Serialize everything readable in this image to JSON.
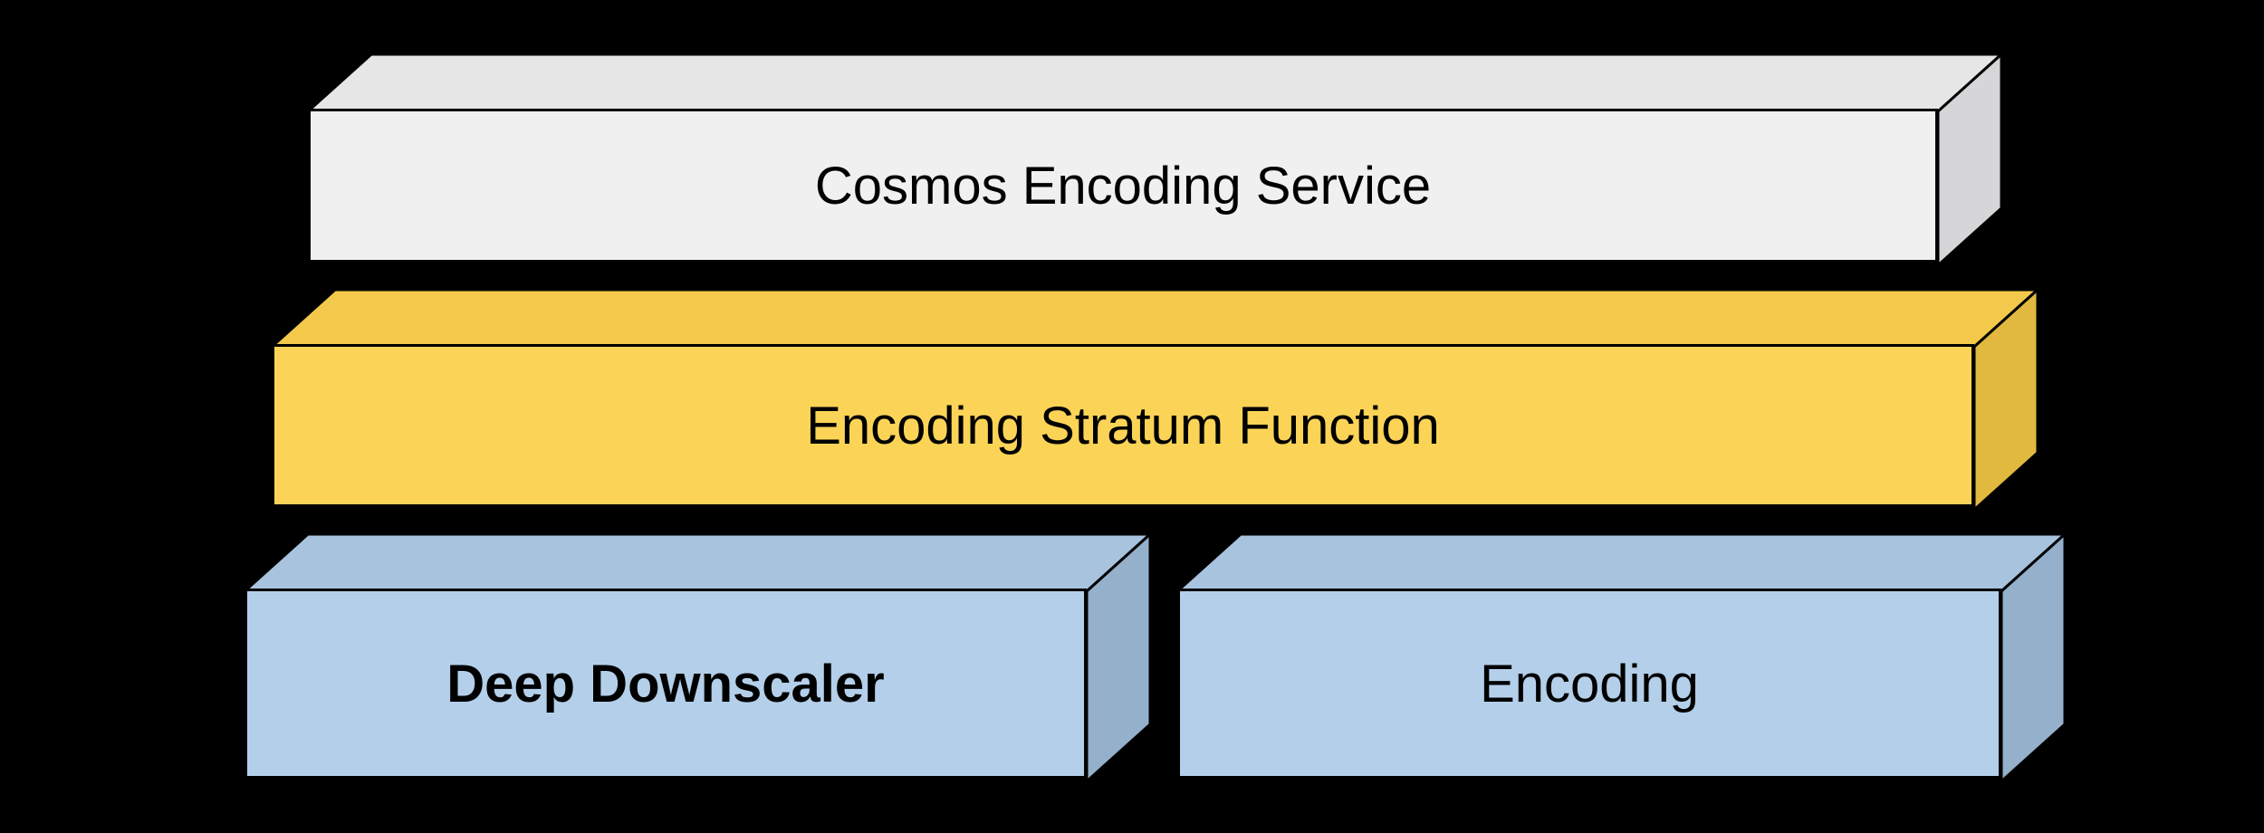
{
  "layers": {
    "top": {
      "label": "Cosmos Encoding Service",
      "colors": {
        "front": "#f0f0f1",
        "top": "#e6e6e7",
        "side": "#d6d6d8"
      }
    },
    "middle": {
      "label": "Encoding Stratum Function",
      "colors": {
        "front": "#fbd457",
        "top": "#f2c94a",
        "side": "#e2b93f"
      }
    },
    "bottomLeft": {
      "label": "Deep Downscaler",
      "colors": {
        "front": "#b4cfe9",
        "top": "#a7c3de",
        "side": "#95b0cb"
      }
    },
    "bottomRight": {
      "label": "Encoding",
      "colors": {
        "front": "#b4cfe9",
        "top": "#a7c3de",
        "side": "#95b0cb"
      }
    }
  }
}
